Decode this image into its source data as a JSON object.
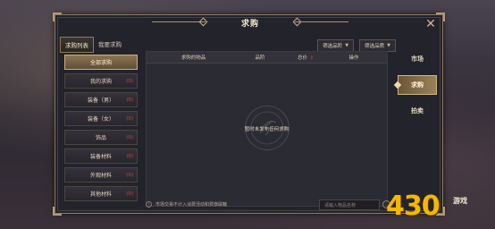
{
  "window": {
    "title": "求购"
  },
  "top_tabs": [
    {
      "label": "求购列表",
      "active": true
    },
    {
      "label": "我要求购",
      "active": false
    }
  ],
  "filters": [
    {
      "label": "筛选品阶"
    },
    {
      "label": "筛选品质"
    }
  ],
  "categories": [
    {
      "label": "全部求购",
      "count": "",
      "active": true
    },
    {
      "label": "我的求购",
      "count": "(0)",
      "active": false
    },
    {
      "label": "装备（男）",
      "count": "(0)",
      "active": false
    },
    {
      "label": "装备（女）",
      "count": "(0)",
      "active": false
    },
    {
      "label": "饰品",
      "count": "(0)",
      "active": false
    },
    {
      "label": "装备材料",
      "count": "(0)",
      "active": false
    },
    {
      "label": "外观材料",
      "count": "(0)",
      "active": false
    },
    {
      "label": "其他材料",
      "count": "(0)",
      "active": false
    }
  ],
  "table": {
    "columns": [
      {
        "label": "求购的物品"
      },
      {
        "label": "品阶"
      },
      {
        "label": "总价",
        "sort": "⇕"
      },
      {
        "label": "操作"
      }
    ],
    "empty_text": "暂时未发布任何求购"
  },
  "footer": {
    "note": "市场交易不计入消费活动和费旗磁輪",
    "search_placeholder": "请输入物品名称"
  },
  "side_tabs": [
    {
      "label": "市场",
      "active": false
    },
    {
      "label": "求购",
      "active": true
    },
    {
      "label": "拍卖",
      "active": false
    }
  ],
  "watermark": {
    "main": "430",
    "small": "游戏"
  },
  "colors": {
    "accent": "#c8ae7c",
    "count_red": "#d2463a"
  }
}
